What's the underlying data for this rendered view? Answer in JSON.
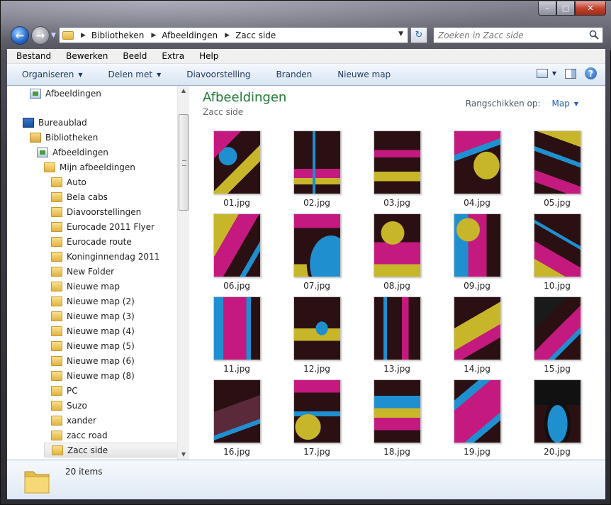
{
  "window": {
    "caption": {
      "minimize": "–",
      "maximize": "□",
      "close": "✕"
    }
  },
  "address": {
    "crumbs": [
      "Bibliotheken",
      "Afbeeldingen",
      "Zacc side"
    ],
    "search_placeholder": "Zoeken in Zacc side"
  },
  "menubar": [
    "Bestand",
    "Bewerken",
    "Beeld",
    "Extra",
    "Help"
  ],
  "commandbar": {
    "organize": "Organiseren",
    "share": "Delen met",
    "slideshow": "Diavoorstelling",
    "burn": "Branden",
    "new_folder": "Nieuwe map"
  },
  "nav": {
    "top_item": "Afbeeldingen",
    "desktop": "Bureaublad",
    "libraries": "Bibliotheken",
    "pictures": "Afbeeldingen",
    "my_pictures": "Mijn afbeeldingen",
    "folders": [
      "Auto",
      "Bela cabs",
      "Diavoorstellingen",
      "Eurocade 2011 Flyer",
      "Eurocade route",
      "Koninginnendag 2011",
      "New Folder",
      "Nieuwe map",
      "Nieuwe map (2)",
      "Nieuwe map (3)",
      "Nieuwe map (4)",
      "Nieuwe map (5)",
      "Nieuwe map (6)",
      "Nieuwe map (8)",
      "PC",
      "Suzo",
      "xander",
      "zacc road",
      "Zacc side"
    ],
    "selected": "Zacc side"
  },
  "content": {
    "title": "Afbeeldingen",
    "subtitle": "Zacc side",
    "arrange_label": "Rangschikken op:",
    "arrange_value": "Map",
    "files": [
      "01.jpg",
      "02.jpg",
      "03.jpg",
      "04.jpg",
      "05.jpg",
      "06.jpg",
      "07.jpg",
      "08.jpg",
      "09.jpg",
      "10.jpg",
      "11.jpg",
      "12.jpg",
      "13.jpg",
      "14.jpg",
      "15.jpg",
      "16.jpg",
      "17.jpg",
      "18.jpg",
      "19.jpg",
      "20.jpg"
    ]
  },
  "details": {
    "count": "20 items"
  },
  "colors": {
    "magenta": "#c4197f",
    "cyan": "#1f8fd0",
    "yellow": "#c8b62a",
    "dark": "#2a1012",
    "title_green": "#1e7a34",
    "link_blue": "#1c5fb5"
  }
}
